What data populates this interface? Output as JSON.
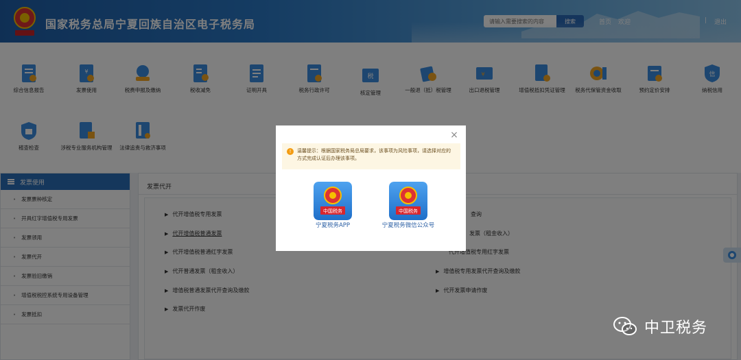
{
  "header": {
    "title": "国家税务总局宁夏回族自治区电子税务局",
    "search_placeholder": "请输入需要搜索的内容",
    "search_button": "搜索",
    "home": "首页",
    "welcome": "欢迎",
    "separator": "|",
    "logout": "退出"
  },
  "icons": [
    {
      "label": "综合信息报告",
      "icon": "report-icon"
    },
    {
      "label": "发票使用",
      "icon": "invoice-icon"
    },
    {
      "label": "税费申报及缴纳",
      "icon": "tax-declare-icon"
    },
    {
      "label": "税收减免",
      "icon": "tax-reduce-icon"
    },
    {
      "label": "证明开具",
      "icon": "certificate-icon"
    },
    {
      "label": "税务行政许可",
      "icon": "permit-icon"
    },
    {
      "label": "核定管理",
      "icon": "verify-icon"
    },
    {
      "label": "一般退（抵）税管理",
      "icon": "refund-icon"
    },
    {
      "label": "出口退税管理",
      "icon": "export-refund-icon"
    },
    {
      "label": "增值税抵扣凭证管理",
      "icon": "vat-deduct-icon"
    },
    {
      "label": "税务代保管资金收取",
      "icon": "custody-icon"
    },
    {
      "label": "预约定价安排",
      "icon": "pricing-icon"
    },
    {
      "label": "纳税信用",
      "icon": "credit-icon"
    },
    {
      "label": "稽查检查",
      "icon": "inspection-icon"
    },
    {
      "label": "涉税专业服务机构管理",
      "icon": "agency-icon"
    },
    {
      "label": "法律追责与救济事项",
      "icon": "law-icon"
    }
  ],
  "sidebar": {
    "title": "发票使用",
    "items": [
      {
        "label": "发票票种核定"
      },
      {
        "label": "开具红字增值税专用发票"
      },
      {
        "label": "发票领用"
      },
      {
        "label": "发票代开"
      },
      {
        "label": "发票验旧缴销"
      },
      {
        "label": "增值税税控系统专用设备管理"
      },
      {
        "label": "发票抵扣"
      }
    ]
  },
  "main": {
    "title": "发票代开",
    "links": [
      {
        "label": "代开增值税专用发票",
        "tri": "▶"
      },
      {
        "label": "代开增值税普通发票",
        "tri": "▶"
      },
      {
        "label": "代开增值税普通红字发票",
        "tri": "▶"
      },
      {
        "label": "代开普通发票（租金收入）",
        "tri": "▶"
      },
      {
        "label": "增值税普通发票代开查询及缴款",
        "tri": "▶"
      },
      {
        "label": "发票代开作废",
        "tri": "▶"
      },
      {
        "label": "查询",
        "tri": ""
      },
      {
        "label": "发票（租金收入）",
        "tri": ""
      },
      {
        "label": "代开增值税专用红字发票",
        "tri": ""
      },
      {
        "label": "增值税专用发票代开查询及缴款",
        "tri": "▶"
      },
      {
        "label": "代开发票申请作废",
        "tri": "▶"
      }
    ]
  },
  "modal": {
    "close": "×",
    "notice_icon": "!",
    "notice": "温馨提示：根据国家税务局总局要求，该事项为风险事项，请选择对应的方式完成认证后办理该事项。",
    "apps": [
      {
        "label": "宁夏税务APP"
      },
      {
        "label": "宁夏税务微信公众号"
      }
    ],
    "badge_text": "中国税务"
  },
  "watermark": {
    "text": "中卫税务"
  },
  "colors": {
    "header": "#2a78c5",
    "accent": "#2a6fb9",
    "notice_bg": "#fdf6e3",
    "app_blue": "#3a8de0"
  }
}
